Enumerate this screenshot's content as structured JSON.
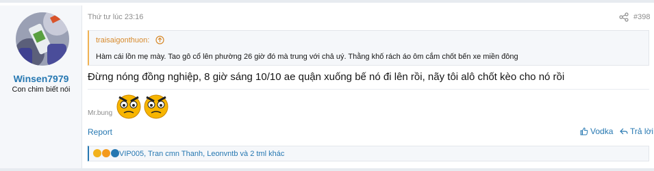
{
  "user": {
    "name": "Winsen7979",
    "title": "Con chim biết nói"
  },
  "post": {
    "date": "Thứ tư lúc 23:16",
    "number": "#398",
    "quote": {
      "author": "traisaigonthuon:",
      "text": "Hàm cái lồn mẹ mày. Tao gô cổ lên phường 26 giờ đó mà trung với chả uý. Thằng khố rách áo ôm cắm chốt bến xe miền đông"
    },
    "message": "Đừng nóng đồng nghiệp, 8 giờ sáng 10/10 ae quận xuống bế nó đi lên rồi, nãy tôi alô chốt kèo cho nó rồi",
    "signature_label": "Mr.bung"
  },
  "actions": {
    "report": "Report",
    "like": "Vodka",
    "reply": "Trả lời"
  },
  "reactions": {
    "text": "VIP005, Tran cmn Thanh, Leonvntb và 2 tml khác",
    "icons": [
      "laugh-reaction",
      "wow-reaction",
      "like-reaction"
    ]
  },
  "colors": {
    "link": "#2577b1",
    "quote_accent": "#f0b252",
    "muted": "#8c8c8c"
  }
}
